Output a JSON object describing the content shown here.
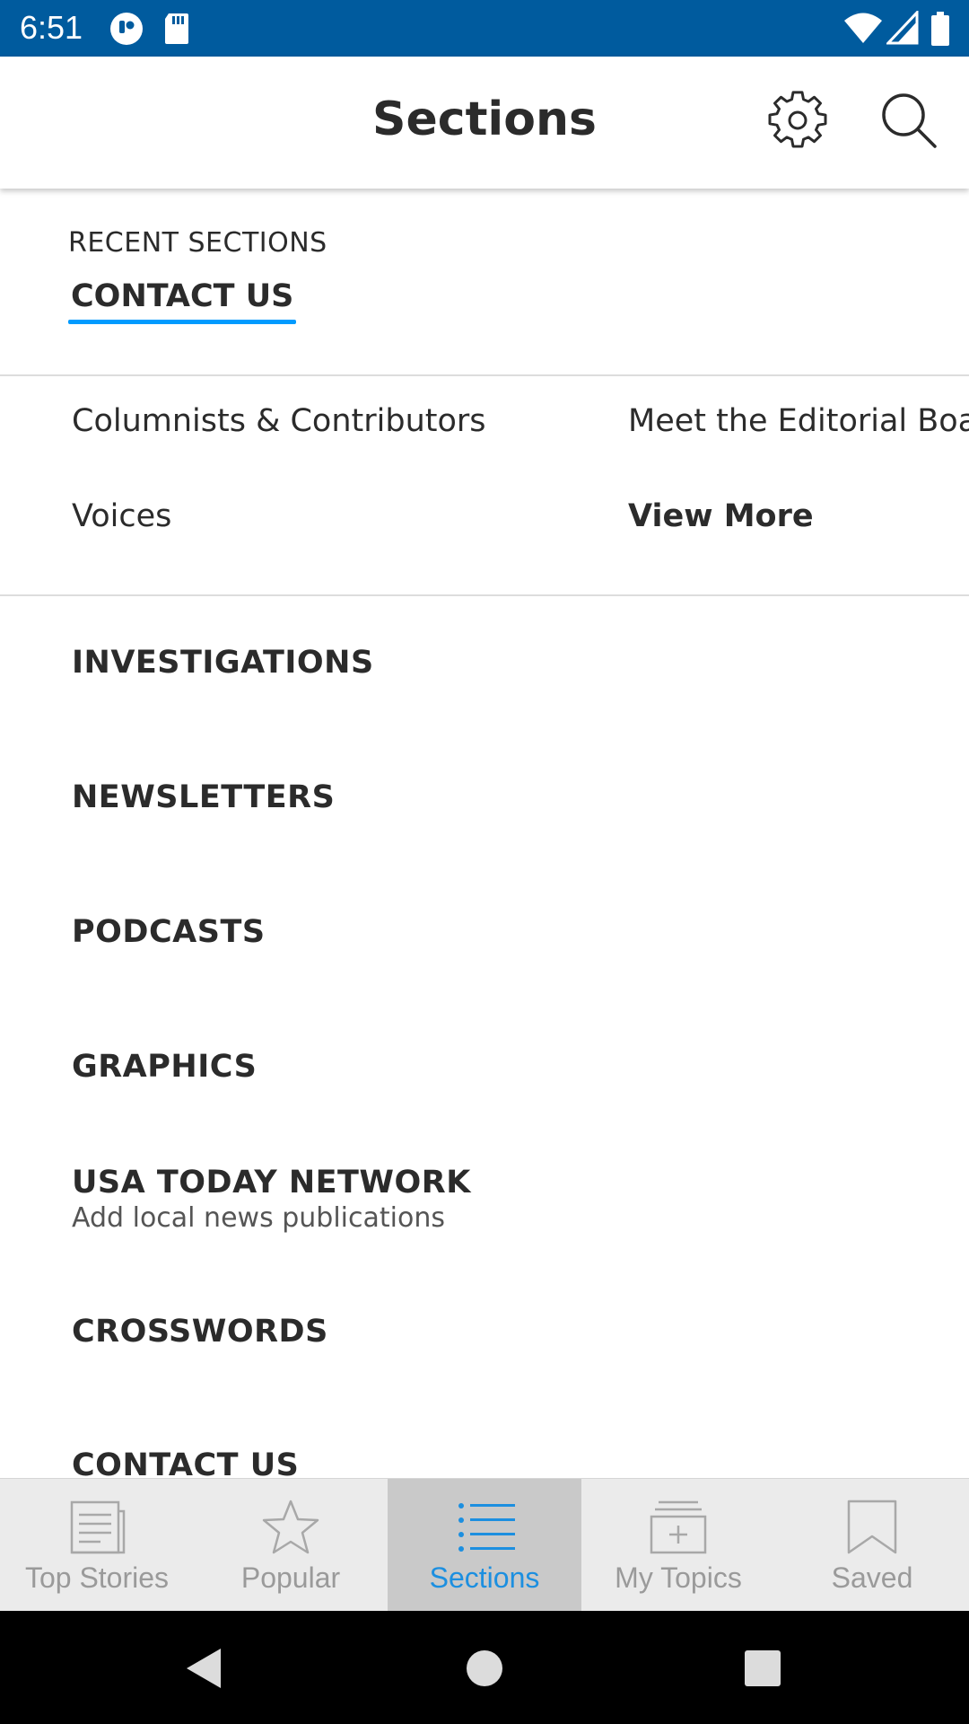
{
  "status_bar": {
    "time": "6:51",
    "icons": [
      "sim-card-icon",
      "sd-card-icon",
      "wifi-icon",
      "cell-signal-icon",
      "battery-icon"
    ],
    "background": "#005b9e"
  },
  "header": {
    "title": "Sections",
    "settings_icon": "gear-icon",
    "search_icon": "search-icon"
  },
  "recent": {
    "label": "RECENT SECTIONS",
    "items": [
      {
        "label": "CONTACT US"
      }
    ],
    "accent": "#009bff"
  },
  "sublinks": {
    "items": [
      {
        "label": "Columnists & Contributors"
      },
      {
        "label": "Meet the Editorial Boa"
      },
      {
        "label": "Voices"
      },
      {
        "label": "View More"
      }
    ]
  },
  "sections": {
    "items": [
      {
        "name": "INVESTIGATIONS"
      },
      {
        "name": "NEWSLETTERS"
      },
      {
        "name": "PODCASTS"
      },
      {
        "name": "GRAPHICS"
      },
      {
        "name": "USA TODAY NETWORK",
        "subtitle": "Add local news publications"
      },
      {
        "name": "CROSSWORDS"
      },
      {
        "name": "CONTACT US"
      }
    ]
  },
  "bottom_nav": {
    "tabs": [
      {
        "label": "Top Stories",
        "icon": "newspaper-icon"
      },
      {
        "label": "Popular",
        "icon": "star-icon"
      },
      {
        "label": "Sections",
        "icon": "list-icon",
        "active": true
      },
      {
        "label": "My Topics",
        "icon": "add-topic-icon"
      },
      {
        "label": "Saved",
        "icon": "bookmark-icon"
      }
    ],
    "active_color": "#1c8fe0"
  },
  "system_nav": {
    "icons": [
      "back-icon",
      "home-icon",
      "recents-icon"
    ]
  }
}
